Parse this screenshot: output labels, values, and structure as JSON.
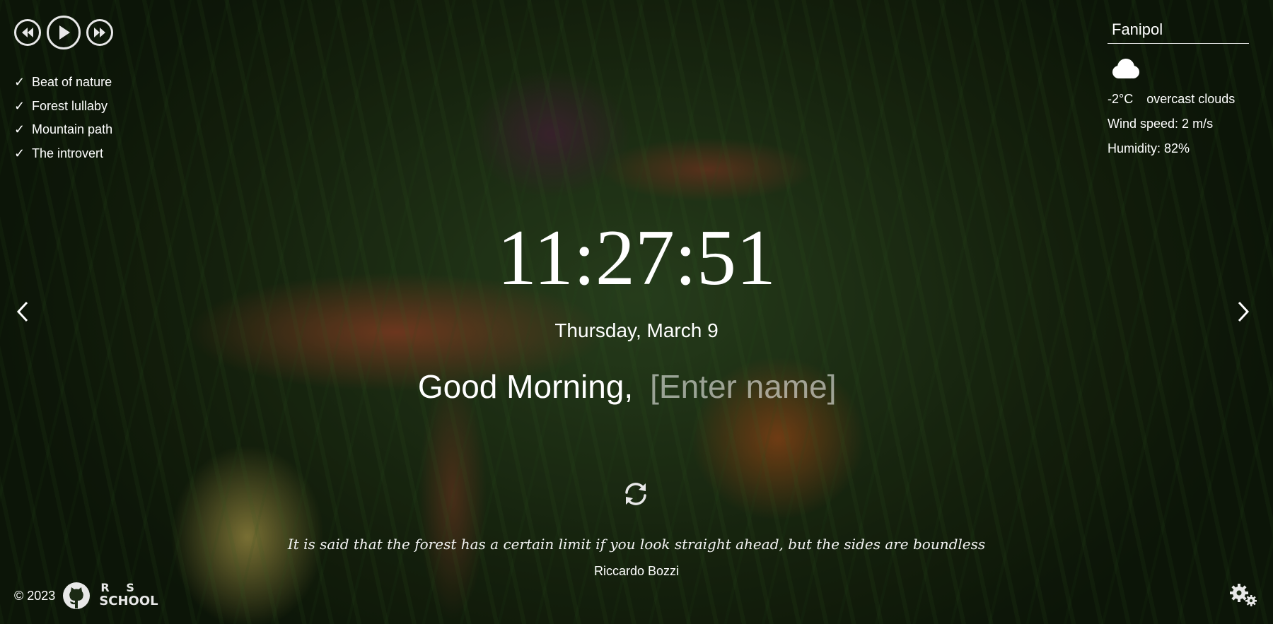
{
  "player": {
    "prev_icon": "rewind-icon",
    "play_icon": "play-icon",
    "next_icon": "fast-forward-icon",
    "playlist": [
      {
        "check": "✓",
        "title": "Beat of nature"
      },
      {
        "check": "✓",
        "title": "Forest lullaby"
      },
      {
        "check": "✓",
        "title": "Mountain path"
      },
      {
        "check": "✓",
        "title": "The introvert"
      }
    ]
  },
  "weather": {
    "city": "Fanipol",
    "icon": "cloud-icon",
    "temperature": "-2°C",
    "description": "overcast clouds",
    "wind": "Wind speed: 2 m/s",
    "humidity": "Humidity: 82%"
  },
  "clock": {
    "time": "11:27:51",
    "date": "Thursday, March 9"
  },
  "greeting": {
    "text": "Good Morning,",
    "name_placeholder": "[Enter name]",
    "name_value": ""
  },
  "quote": {
    "text": "It is said that the forest has a certain limit if you look straight ahead, but the sides are boundless",
    "author": "Riccardo Bozzi"
  },
  "footer": {
    "copyright": "© 2023",
    "github_icon": "github-icon",
    "school_logo": {
      "r": "R",
      "s": "S",
      "school": "SCHOOL"
    }
  },
  "colors": {
    "text": "#ffffff",
    "control_border": "#e8e8e8"
  }
}
